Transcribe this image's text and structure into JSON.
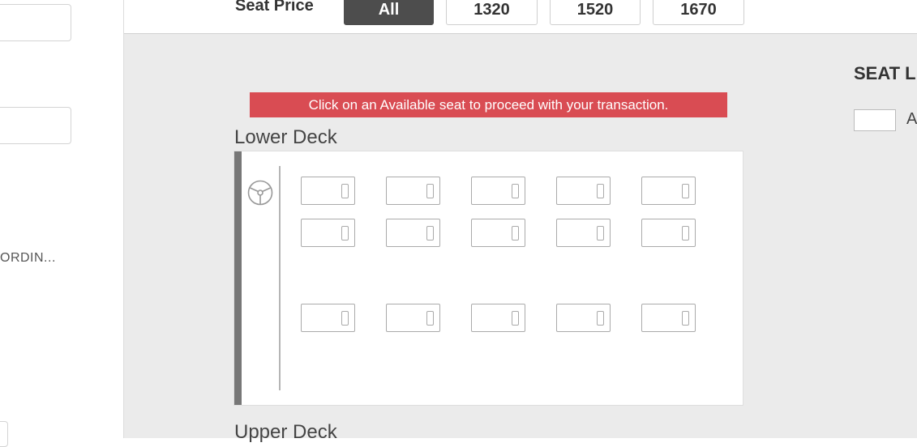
{
  "left_panel": {
    "truncated_text": "ORDIN..."
  },
  "filter_bar": {
    "label": "Seat Price",
    "options": [
      {
        "label": "All",
        "active": true
      },
      {
        "label": "1320",
        "active": false
      },
      {
        "label": "1520",
        "active": false
      },
      {
        "label": "1670",
        "active": false
      }
    ]
  },
  "notice": "Click on an Available seat to proceed with your transaction.",
  "lower_deck": {
    "title": "Lower Deck",
    "steering_icon": "steering-wheel-icon",
    "seat_rows": [
      [
        "sleeper",
        "sleeper",
        "sleeper",
        "sleeper",
        "sleeper"
      ],
      [
        "sleeper",
        "sleeper",
        "sleeper",
        "sleeper",
        "sleeper"
      ],
      [
        "sleeper",
        "sleeper",
        "sleeper",
        "sleeper",
        "sleeper"
      ]
    ]
  },
  "upper_deck": {
    "title": "Upper Deck"
  },
  "legend": {
    "title": "SEAT L",
    "items": [
      {
        "label": "A"
      }
    ]
  },
  "colors": {
    "notice_bg": "#d94c53",
    "active_filter_bg": "#4d4d4d",
    "main_bg": "#ebebeb",
    "deck_edge": "#777777"
  }
}
